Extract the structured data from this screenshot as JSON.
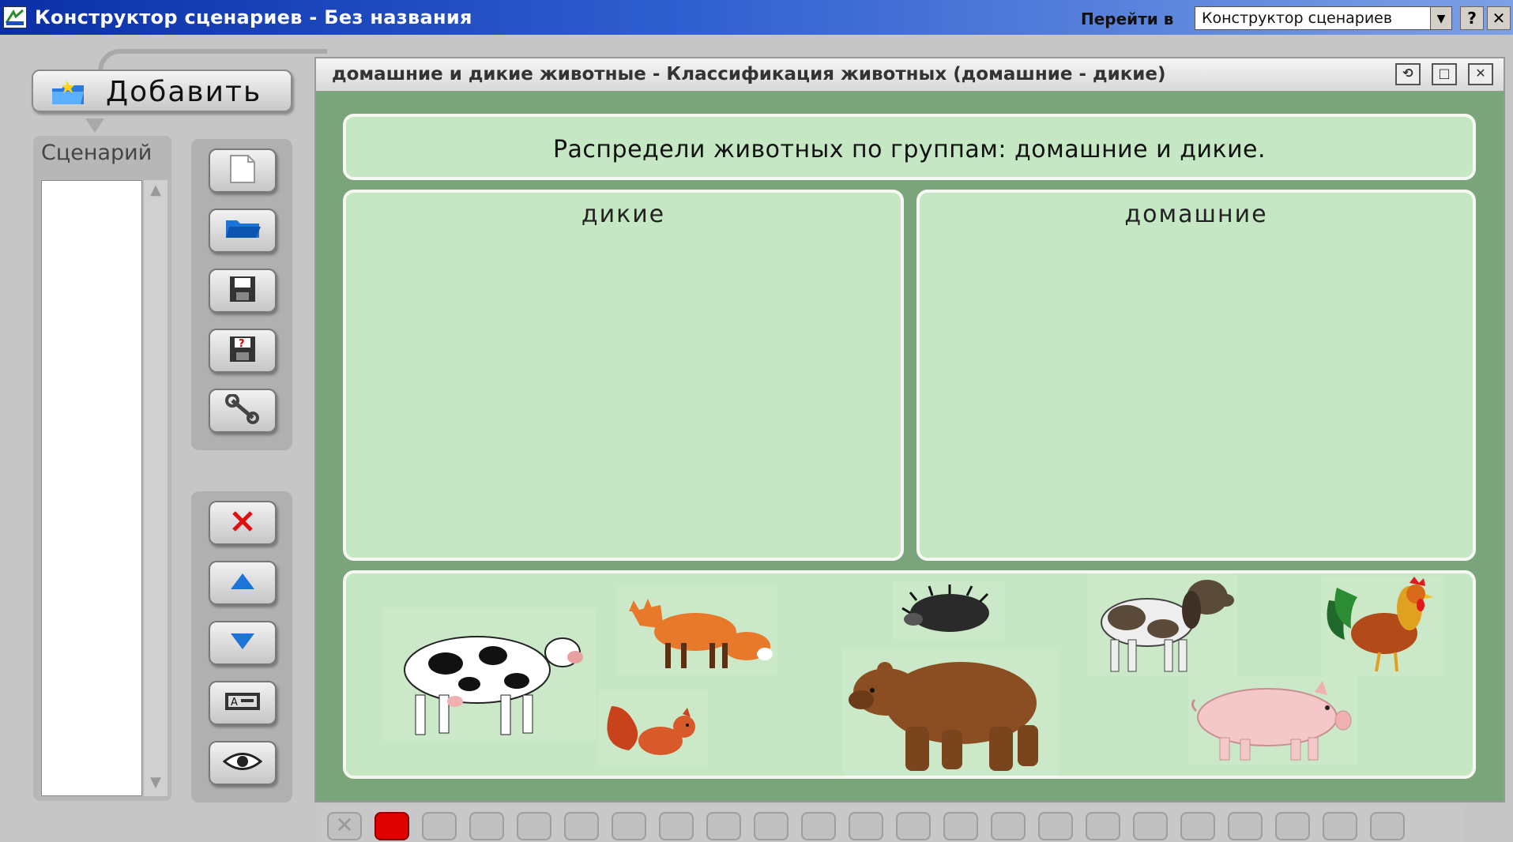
{
  "window": {
    "title": "Конструктор сценариев - Без названия",
    "goto_label": "Перейти в",
    "goto_value": "Конструктор сценариев",
    "help_label": "?",
    "close_label": "✕"
  },
  "sidebar": {
    "add_label": "Добавить",
    "scenario_header": "Сценарий",
    "tools_top": [
      "new-document-icon",
      "open-folder-icon",
      "save-icon",
      "save-as-icon",
      "settings-wrench-icon"
    ],
    "tools_bottom": [
      "delete-icon",
      "move-up-icon",
      "move-down-icon",
      "rename-icon",
      "preview-eye-icon"
    ]
  },
  "main": {
    "title": "домашние и дикие животные - Классификация животных (домашние - дикие)",
    "instruction": "Распредели животных по группам: домашние и дикие.",
    "zone_wild": "дикие",
    "zone_domestic": "домашние",
    "animals": [
      "cow",
      "fox",
      "squirrel",
      "hedgehog",
      "bear",
      "dog",
      "rooster",
      "pig"
    ]
  },
  "slides": {
    "close_label": "✕",
    "count": 22,
    "active_index": 0
  },
  "colors": {
    "accent_green": "#c6e7c4",
    "panel_green": "#7aa57a",
    "active_slide": "#e00000"
  }
}
